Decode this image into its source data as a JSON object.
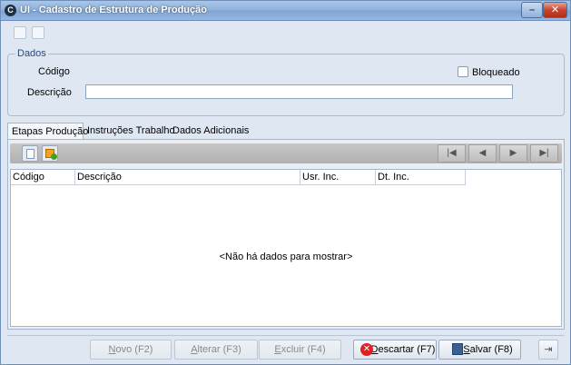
{
  "window": {
    "title": "UI - Cadastro de Estrutura de Produção",
    "icon": "app-logo-icon",
    "minimize_glyph": "–",
    "close_glyph": "✕"
  },
  "dados": {
    "legend": "Dados",
    "codigo_label": "Código",
    "descricao_label": "Descrição",
    "descricao_value": "",
    "bloqueado_label": "Bloqueado"
  },
  "tabs": [
    {
      "label": "Etapas Produção"
    },
    {
      "label": "Instruções Trabalho"
    },
    {
      "label": "Dados Adicionais"
    }
  ],
  "grid": {
    "columns": [
      "Código",
      "Descrição",
      "Usr. Inc.",
      "Dt. Inc."
    ],
    "empty_message": "<Não há dados para mostrar>"
  },
  "nav": {
    "first": "|◀",
    "prev": "◀",
    "next": "▶",
    "last": "▶|"
  },
  "actions": {
    "novo": {
      "letter": "N",
      "rest": "ovo (F2)"
    },
    "alterar": {
      "letter": "A",
      "rest": "lterar (F3)"
    },
    "excluir": {
      "letter": "E",
      "rest": "xcluir (F4)"
    },
    "descartar": {
      "letter": "D",
      "rest": "escartar (F7)"
    },
    "salvar": {
      "letter": "S",
      "rest": "alvar (F8)"
    }
  },
  "exit_glyph": "⇥"
}
